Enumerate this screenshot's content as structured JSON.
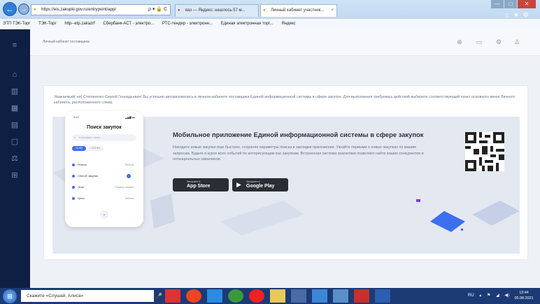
{
  "browser": {
    "address": "https://eis.zakupki.gov.ru/entrypoint/app/",
    "address_controls": "ρ ▾ 🔒 C",
    "tabs": [
      {
        "label": "ваз — Яндекс: нашлось 57 м..."
      },
      {
        "label": "Личный кабинет участник..."
      }
    ],
    "window_controls": [
      "—",
      "□",
      "✕"
    ],
    "bookmarks": [
      "ЭТП ТЭК-Торг",
      "ТЭК-Торг",
      "http--etp.zakazrf",
      "Сбербанк-АСТ - электро...",
      "РТС-тендер - электронн...",
      "Единая электронная торг...",
      "Яндекс"
    ]
  },
  "app": {
    "breadcrumb": "Личный кабинет поставщика",
    "sidebar_icons": [
      "home-icon",
      "bank-icon",
      "grid-icon",
      "document-icon",
      "chat-icon",
      "gavel-icon",
      "directory-icon"
    ],
    "welcome_text": "Уважаемый(-ая) Степаненко Сергей Геннадьевич! Вы успешно авторизовались в личном кабинете поставщика Единой информационной системы в сфере закупок. Для выполнения требуемых действий выберите соответствующий пункт основного меню Личного кабинета, расположенного слева.",
    "banner": {
      "title": "Мобильное приложение Единой информационной системы в сфере закупок",
      "description": "Находите новые закупки еще быстрее, сохраняя параметры поиска в закладки приложения. Узнайте первыми о новых закупках по вашим запросам. Будьте в курсе всех событий по интересующим вас закупкам. Встроенная система аналитики позволяет найти ваших конкурентов и потенциальных заказчиков.",
      "app_store": {
        "small": "Загрузите в",
        "big": "App Store"
      },
      "google_play": {
        "small": "Загрузите в",
        "big": "Google Play"
      }
    },
    "phone": {
      "time": "9:41",
      "status": "▂▄▆ ▬",
      "title": "Поиск закупок",
      "search_placeholder": "Ключевое слово",
      "chips": [
        "44-ФЗ",
        "223-ФЗ"
      ],
      "rows": [
        {
          "label": "Регион",
          "value": "Любой"
        },
        {
          "label": "Способ закупки",
          "value": ""
        },
        {
          "label": "Этап",
          "value": "Подача заявок"
        },
        {
          "label": "Цена",
          "value": "Любая"
        }
      ]
    }
  },
  "taskbar": {
    "search_text": "Скажите «Слушай, Алиса»",
    "lang": "RU",
    "time": "13:44",
    "date": "05.08.2021"
  },
  "colors": {
    "sidebar": "#0f1f44",
    "accent": "#3b6ff0",
    "taskbar": "#1c3a74"
  }
}
